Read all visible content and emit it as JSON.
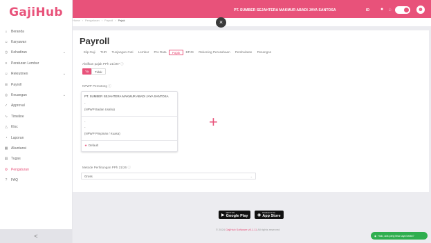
{
  "brand": {
    "logo_text": "GajiHub",
    "accent_color": "#e8527a"
  },
  "topbar": {
    "company": "PT. SUMBER SEJAHTERA MAKMUR ABADI JAYA SANTOSA",
    "lang": "ID",
    "help_icon": "info-icon",
    "notif_icon": "bell-icon"
  },
  "sidebar": {
    "items": [
      {
        "label": "Beranda",
        "icon": "home-icon",
        "chevron": false
      },
      {
        "label": "Karyawan",
        "icon": "user-icon",
        "chevron": false
      },
      {
        "label": "Kehadiran",
        "icon": "clock-icon",
        "chevron": true
      },
      {
        "label": "Peraturan Lembur",
        "icon": "rules-icon",
        "chevron": false
      },
      {
        "label": "Rekrutmen",
        "icon": "people-icon",
        "chevron": true
      },
      {
        "label": "Payroll",
        "icon": "payroll-icon",
        "chevron": false
      },
      {
        "label": "Keuangan",
        "icon": "money-icon",
        "chevron": true
      },
      {
        "label": "Approval",
        "icon": "approval-icon",
        "chevron": false
      },
      {
        "label": "Timeline",
        "icon": "timeline-icon",
        "chevron": false
      },
      {
        "label": "Kloc",
        "icon": "kloc-icon",
        "chevron": false
      },
      {
        "label": "Laporan",
        "icon": "report-icon",
        "chevron": false
      },
      {
        "label": "Akuntansi",
        "icon": "accounting-icon",
        "chevron": false
      },
      {
        "label": "Tugas",
        "icon": "task-icon",
        "chevron": false
      },
      {
        "label": "Pengaturan",
        "icon": "gear-icon",
        "chevron": false,
        "active": true
      },
      {
        "label": "FAQ",
        "icon": "question-icon",
        "chevron": false
      }
    ],
    "collapse_label": "<"
  },
  "breadcrumb": [
    "Home",
    "Pengaturan",
    "Payroll",
    "Pajak"
  ],
  "close_label": "×",
  "page": {
    "title": "Payroll",
    "tabs": [
      "Slip Gaji",
      "THR",
      "Tunjangan Cuti",
      "Lembur",
      "Pro Rata",
      "Pajak",
      "BPJS",
      "Rekening Perusahaan",
      "Pembulatan",
      "Pesangon"
    ],
    "active_tab": "Pajak",
    "pph_label": "Aktifkan pajak PPh 21/26?",
    "pph_options": {
      "on": "Ya",
      "off": "Tidak"
    },
    "npwp_label": "NPWP Pemotong",
    "npwp_card": {
      "company": "PT. SUMBER SEJAHTERA MAKMUR ABADI JAYA SANTOSA",
      "dash1": "-",
      "entity_label": "(NPWP Badan Usaha)",
      "dash2": "-",
      "dash3": "-",
      "leader_label": "(NPWP Pimpinan / Kuasa)",
      "default_label": "Default"
    },
    "add_symbol": "+",
    "method_label": "Metode Perhitungan PPh 21/26",
    "method_value": "Gross"
  },
  "footer": {
    "google_small": "GET IT ON",
    "google_big": "Google Play",
    "apple_small": "Download on the",
    "apple_big": "App Store",
    "copyright_pre": "© 2024",
    "copyright_brand": "GajiHub Software v8.1.11",
    "copyright_post": "All rights reserved"
  },
  "chat": {
    "label": "Halo, ada yang bisa saya bantu?"
  }
}
